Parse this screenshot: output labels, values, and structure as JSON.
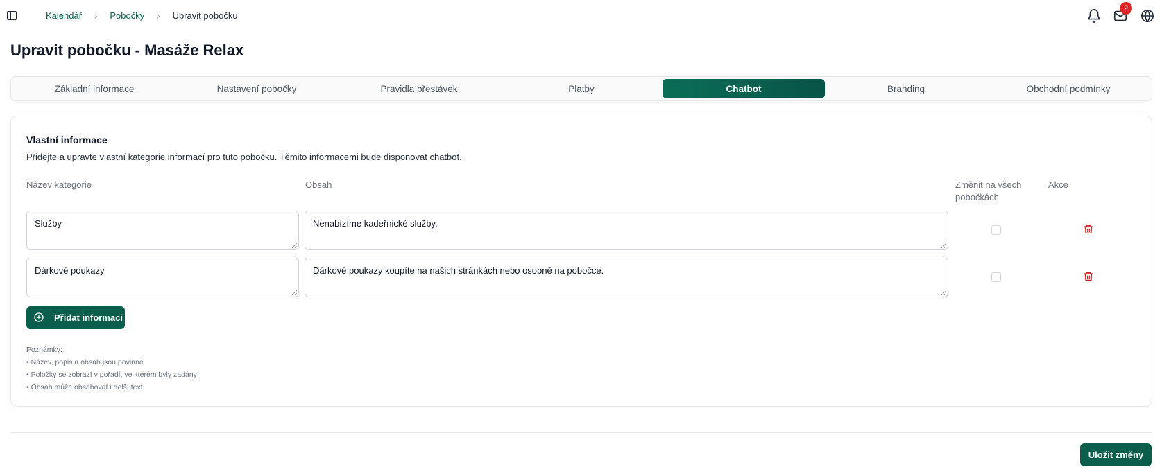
{
  "breadcrumb": {
    "items": [
      "Kalendář",
      "Pobočky"
    ],
    "separator": "›",
    "current": "Upravit pobočku"
  },
  "header": {
    "icons": [
      "sidebar-toggle-icon",
      "bell-icon",
      "mail-icon",
      "globe-icon"
    ],
    "mail_badge": "2"
  },
  "page": {
    "title": "Upravit pobočku - Masáže Relax"
  },
  "tabs": [
    {
      "label": "Základní informace",
      "active": false
    },
    {
      "label": "Nastavení pobočky",
      "active": false
    },
    {
      "label": "Pravidla přestávek",
      "active": false
    },
    {
      "label": "Platby",
      "active": false
    },
    {
      "label": "Chatbot",
      "active": true
    },
    {
      "label": "Branding",
      "active": false
    },
    {
      "label": "Obchodní podmínky",
      "active": false
    }
  ],
  "section": {
    "title": "Vlastní informace",
    "description": "Přidejte a upravte vlastní kategorie informací pro tuto pobočku. Těmito informacemi bude disponovat chatbot."
  },
  "table": {
    "headers": {
      "category": "Název kategorie",
      "content": "Obsah",
      "change_all_1": "Změnit na všech",
      "change_all_2": "pobočkách",
      "actions": "Akce"
    },
    "rows": [
      {
        "category": "Služby",
        "content": "Nenabízíme kadeřnické služby.",
        "change_all": false
      },
      {
        "category": "Dárkové poukazy",
        "content": "Dárkové poukazy koupíte na našich stránkách nebo osobně na pobočce.",
        "change_all": false
      }
    ]
  },
  "buttons": {
    "add": "Přidat informaci",
    "save": "Uložit změny"
  },
  "notes": {
    "title": "Poznámky:",
    "items": [
      "• Název, popis a obsah jsou povinné",
      "• Položky se zobrazí v pořadí, ve kterém byly zadány",
      "• Obsah může obsahovat i delší text"
    ]
  },
  "colors": {
    "primary": "#0b5e4b",
    "danger": "#dc2626"
  }
}
